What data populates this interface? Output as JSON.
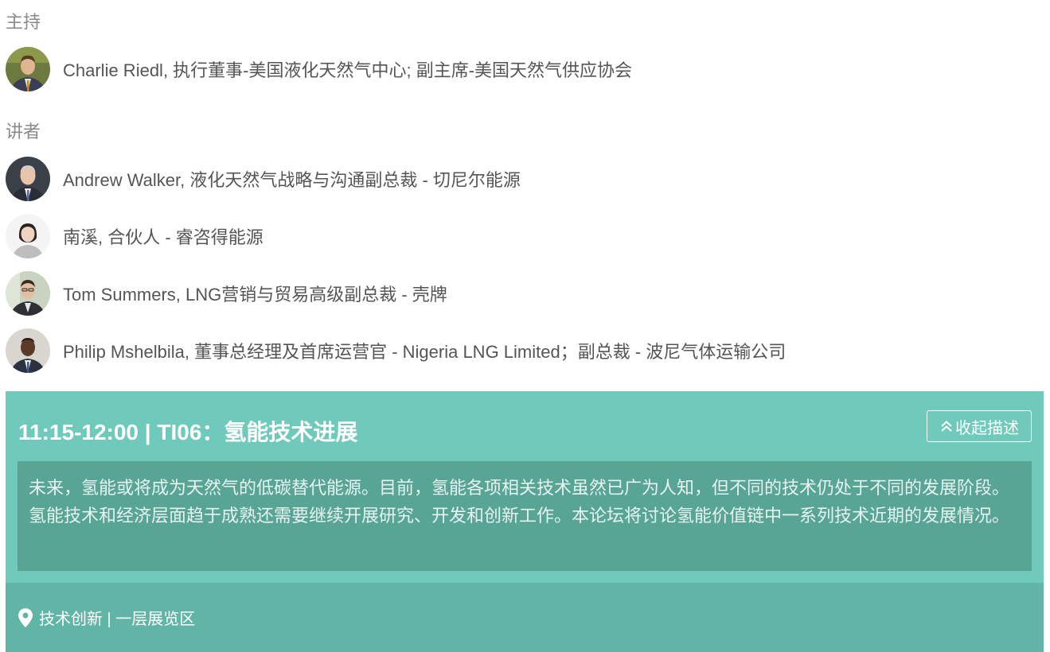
{
  "moderator_label": "主持",
  "speakers_label": "讲者",
  "moderator": {
    "name": "Charlie Riedl",
    "title": ", 执行董事-美国液化天然气中心; 副主席-美国天然气供应协会"
  },
  "speakers": [
    {
      "name": "Andrew Walker",
      "title": ", 液化天然气战略与沟通副总裁 - 切尼尔能源"
    },
    {
      "name": "南溪",
      "title": ", 合伙人 - 睿咨得能源"
    },
    {
      "name": "Tom Summers",
      "title": ", LNG营销与贸易高级副总裁 - 壳牌"
    },
    {
      "name": "Philip Mshelbila",
      "title": ", 董事总经理及首席运营官 - Nigeria LNG Limited；副总裁 - 波尼气体运输公司"
    }
  ],
  "session": {
    "title": "11:15-12:00 | TI06：氢能技术进展",
    "collapse_label": "收起描述",
    "description": "未来，氢能或将成为天然气的低碳替代能源。目前，氢能各项相关技术虽然已广为人知，但不同的技术仍处于不同的发展阶段。氢能技术和经济层面趋于成熟还需要继续开展研究、开发和创新工作。本论坛将讨论氢能价值链中一系列技术近期的发展情况。",
    "location": "技术创新 | 一层展览区"
  },
  "colors": {
    "session_bg": "#6fcabb",
    "description_bg": "#58a596",
    "footer_bg": "#60b5a6"
  }
}
